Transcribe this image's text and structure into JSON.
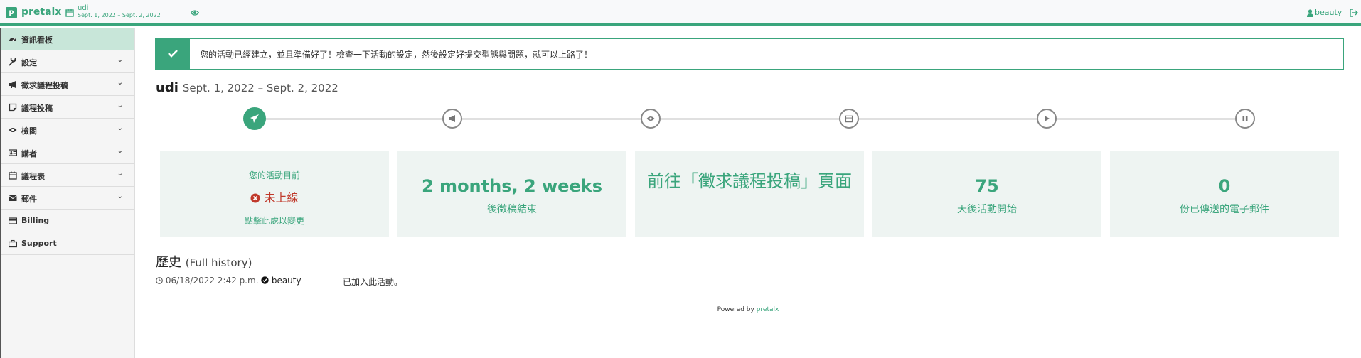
{
  "topbar": {
    "logo_letter": "p",
    "brand": "pretalx",
    "event_name": "udi",
    "event_dates": "Sept. 1, 2022 – Sept. 2, 2022",
    "user": "beauty"
  },
  "sidebar": {
    "items": [
      {
        "label": "資訊看板",
        "icon": "dashboard-icon",
        "expandable": false,
        "active": true
      },
      {
        "label": "設定",
        "icon": "wrench-icon",
        "expandable": true
      },
      {
        "label": "徵求議程投稿",
        "icon": "bullhorn-icon",
        "expandable": true
      },
      {
        "label": "議程投稿",
        "icon": "sticky-note-icon",
        "expandable": true
      },
      {
        "label": "檢閱",
        "icon": "eye-icon",
        "expandable": true
      },
      {
        "label": "講者",
        "icon": "id-card-icon",
        "expandable": true
      },
      {
        "label": "議程表",
        "icon": "calendar-icon",
        "expandable": true
      },
      {
        "label": "郵件",
        "icon": "envelope-icon",
        "expandable": true
      },
      {
        "label": "Billing",
        "icon": "credit-card-icon",
        "expandable": false
      },
      {
        "label": "Support",
        "icon": "briefcase-icon",
        "expandable": false
      }
    ]
  },
  "alert": {
    "text": "您的活動已經建立，並且準備好了！檢查一下活動的設定，然後設定好提交型態與問題，就可以上路了！"
  },
  "header": {
    "event": "udi",
    "dates": "Sept. 1, 2022 – Sept. 2, 2022"
  },
  "timeline": {
    "steps": [
      {
        "icon": "paper-plane-icon",
        "done": true
      },
      {
        "icon": "bullhorn-icon",
        "done": false
      },
      {
        "icon": "eye-icon",
        "done": false
      },
      {
        "icon": "calendar-icon",
        "done": false
      },
      {
        "icon": "play-icon",
        "done": false
      },
      {
        "icon": "pause-icon",
        "done": false
      }
    ]
  },
  "cards": {
    "status_label": "您的活動目前",
    "status_value": "未上線",
    "status_action": "點擊此處以變更",
    "cfp_value": "2 months, 2 weeks",
    "cfp_label": "後徵稿結束",
    "cfp_link": "前往「徵求議程投稿」頁面",
    "days_value": "75",
    "days_label": "天後活動開始",
    "mails_value": "0",
    "mails_label": "份已傳送的電子郵件"
  },
  "history": {
    "title": "歷史",
    "full_history": "(Full history)",
    "entries": [
      {
        "timestamp": "06/18/2022 2:42 p.m.",
        "user": "beauty",
        "action": "已加入此活動。"
      }
    ]
  },
  "footer": {
    "powered_by": "Powered by",
    "link": "pretalx"
  },
  "colors": {
    "accent": "#3aa57c",
    "danger": "#c0392b"
  }
}
